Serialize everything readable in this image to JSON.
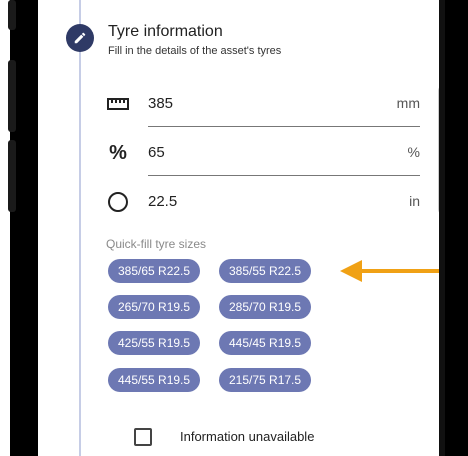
{
  "step": {
    "title": "Tyre information",
    "subtitle": "Fill in the details of the asset's tyres",
    "icon": "pencil-icon"
  },
  "fields": [
    {
      "icon": "ruler-icon",
      "value": "385",
      "unit": "mm"
    },
    {
      "icon": "percent-icon",
      "value": "65",
      "unit": "%"
    },
    {
      "icon": "circle-icon",
      "value": "22.5",
      "unit": "in"
    }
  ],
  "quick_fill": {
    "label": "Quick-fill tyre sizes",
    "chips": [
      "385/65 R22.5",
      "385/55 R22.5",
      "265/70 R19.5",
      "285/70 R19.5",
      "425/55 R19.5",
      "445/45 R19.5",
      "445/55 R19.5",
      "215/75 R17.5"
    ]
  },
  "checkbox": {
    "label": "Information unavailable",
    "checked": false
  },
  "colors": {
    "chip": "#6d78b3",
    "arrow": "#f0a115",
    "step_icon": "#2f3a66"
  }
}
